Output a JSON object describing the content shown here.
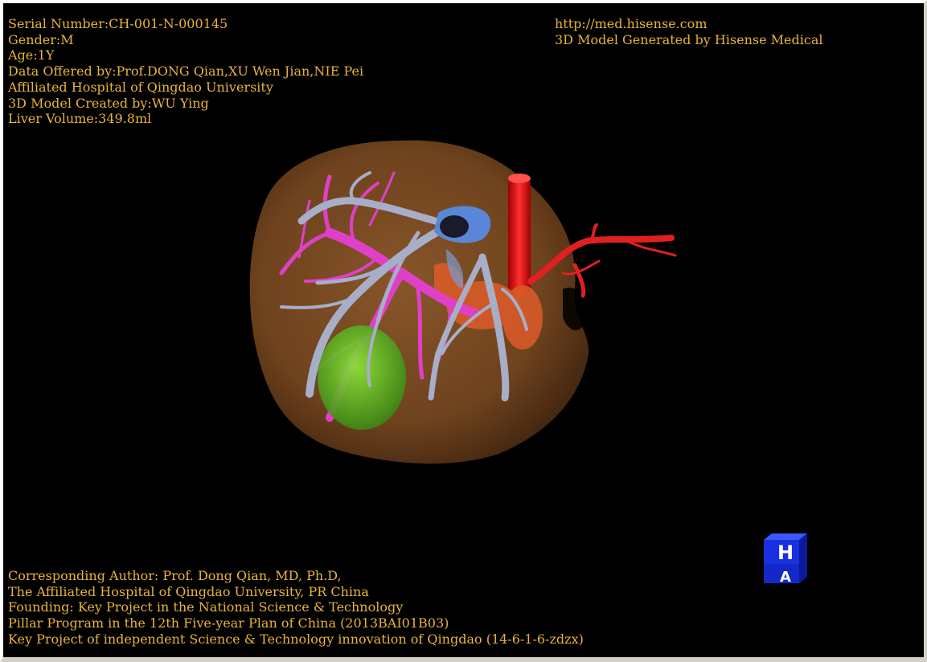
{
  "info": {
    "serial": "Serial Number:CH-001-N-000145",
    "gender": "Gender:M",
    "age": "Age:1Y",
    "data_offered": "Data Offered by:Prof.DONG Qian,XU Wen Jian,NIE Pei",
    "hospital": "Affiliated Hospital of Qingdao University",
    "model_created": "3D Model Created by:WU Ying",
    "liver_volume": "Liver Volume:349.8ml"
  },
  "brand": {
    "url": "http://med.hisense.com",
    "generated_by": "3D Model Generated by Hisense Medical"
  },
  "footer": {
    "line1": "Corresponding Author: Prof. Dong Qian, MD, Ph.D,",
    "line2": "The Affiliated Hospital of Qingdao University, PR China",
    "line3": "Founding: Key Project in the National Science & Technology",
    "line4": "Pillar Program in the 12th Five-year Plan of China (2013BAI01B03)",
    "line5": "Key Project of independent Science & Technology innovation of Qingdao (14-6-1-6-zdzx)"
  },
  "orientation_cube": {
    "top_label": "H",
    "bottom_label": "A"
  },
  "colors": {
    "text": "#e8b43a",
    "background": "#000000",
    "liver": "#7a4a22",
    "portal_vein": "#e040c8",
    "hepatic_vein": "#a0a8c8",
    "artery": "#e02020",
    "gallbladder": "#66cc22",
    "ivc": "#5a86d8"
  }
}
